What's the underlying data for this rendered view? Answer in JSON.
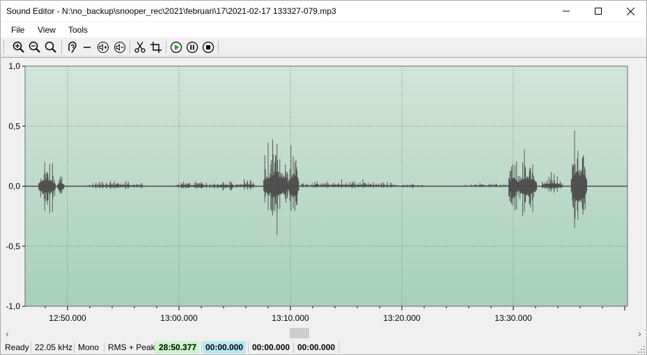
{
  "window": {
    "title": "Sound Editor - N:\\no_backup\\snooper_rec\\2021\\februari\\17\\2021-02-17 133327-079.mp3"
  },
  "menu": {
    "file": "File",
    "view": "View",
    "tools": "Tools"
  },
  "toolbar": {
    "icons": [
      "zoom-in-icon",
      "zoom-out-icon",
      "zoom-fit-icon",
      "ear-icon",
      "minus-icon",
      "volume-up-icon",
      "volume-down-icon",
      "scissors-icon",
      "crop-icon",
      "play-icon",
      "pause-icon",
      "stop-icon"
    ]
  },
  "chart_data": {
    "type": "line",
    "ylim": [
      -1.0,
      1.0
    ],
    "y_ticks": [
      "1,0",
      "0,5",
      "0,0",
      "-0,5",
      "-1,0"
    ],
    "x_ticks": [
      "12:50.000",
      "13:00.000",
      "13:10.000",
      "13:20.000",
      "13:30.000"
    ],
    "grid": true,
    "colors": {
      "background_top": "#d1e5da",
      "background_bottom": "#a8cfb9",
      "waveform": "#4a4a4a",
      "grid": "#6e8a7a"
    },
    "series": [
      {
        "values_note": "",
        "bursts": [
          {
            "start": "12:47.400",
            "end": "12:48.900",
            "peak_pos": 0.27,
            "peak_neg": -0.31
          },
          {
            "start": "12:49.100",
            "end": "12:49.700",
            "peak_pos": 0.16,
            "peak_neg": -0.17
          },
          {
            "start": "12:51.800",
            "end": "12:57.000",
            "peak_pos": 0.05,
            "peak_neg": -0.03
          },
          {
            "start": "12:59.600",
            "end": "13:03.000",
            "peak_pos": 0.05,
            "peak_neg": -0.03
          },
          {
            "start": "13:03.000",
            "end": "13:05.400",
            "peak_pos": 0.05,
            "peak_neg": -0.04
          },
          {
            "start": "13:05.400",
            "end": "13:06.800",
            "peak_pos": 0.07,
            "peak_neg": -0.03
          },
          {
            "start": "13:07.600",
            "end": "13:09.800",
            "peak_pos": 0.52,
            "peak_neg": -0.42
          },
          {
            "start": "13:09.800",
            "end": "13:10.800",
            "peak_pos": 0.46,
            "peak_neg": -0.4
          },
          {
            "start": "13:11.000",
            "end": "13:19.600",
            "peak_pos": 0.06,
            "peak_neg": -0.02
          },
          {
            "start": "13:20.000",
            "end": "13:22.000",
            "peak_pos": 0.03,
            "peak_neg": -0.02
          },
          {
            "start": "13:25.500",
            "end": "13:29.600",
            "peak_pos": 0.03,
            "peak_neg": -0.01
          },
          {
            "start": "13:29.600",
            "end": "13:30.400",
            "peak_pos": 0.35,
            "peak_neg": -0.43
          },
          {
            "start": "13:30.400",
            "end": "13:32.100",
            "peak_pos": 0.35,
            "peak_neg": -0.35
          },
          {
            "start": "13:32.600",
            "end": "13:34.400",
            "peak_pos": 0.12,
            "peak_neg": -0.07
          },
          {
            "start": "13:35.200",
            "end": "13:36.600",
            "peak_pos": 0.6,
            "peak_neg": -0.6
          }
        ]
      }
    ]
  },
  "scrollbar": {
    "left_arrow": "‹",
    "right_arrow": "›",
    "position_fraction": 0.46
  },
  "status": {
    "state": "Ready",
    "sample_rate": "22.05 kHz",
    "channels": "Mono",
    "mode": "RMS + Peak",
    "time_total": "28:50.377",
    "time_cursor": "00:00.000",
    "time_sel_start": "00:00.000",
    "time_sel_len": "00:00.000",
    "color_total": "#c9f7c9",
    "color_cursor": "#b6e8f4"
  }
}
